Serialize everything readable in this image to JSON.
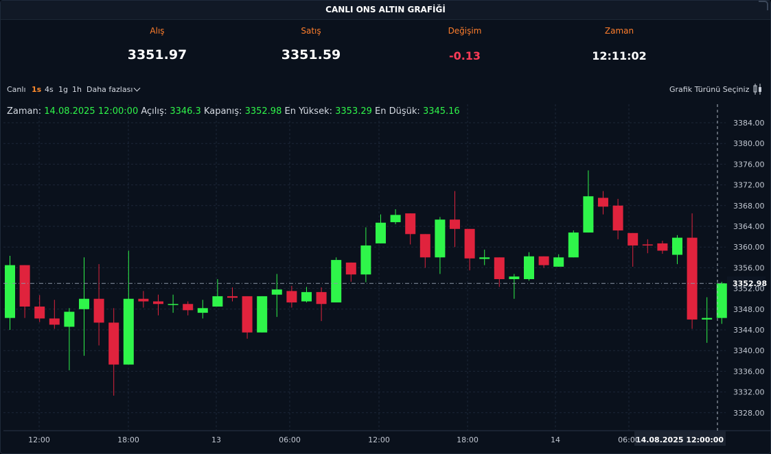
{
  "header": {
    "title": "CANLI ONS ALTIN GRAFİĞİ"
  },
  "quotes": {
    "bid": {
      "label": "Alış",
      "value": "3351.97"
    },
    "ask": {
      "label": "Satış",
      "value": "3351.59"
    },
    "change": {
      "label": "Değişim",
      "value": "-0.13"
    },
    "time": {
      "label": "Zaman",
      "value": "12:11:02"
    }
  },
  "toolbar": {
    "live": "Canlı",
    "intervals": [
      "1s",
      "4s",
      "1g",
      "1h"
    ],
    "active_interval": "1s",
    "more": "Daha fazlası",
    "chart_type": "Grafik Türünü Seçiniz"
  },
  "ohlc": {
    "time_label": "Zaman:",
    "time_value": "14.08.2025 12:00:00",
    "open_label": "Açılış:",
    "open_value": "3346.3",
    "close_label": "Kapanış:",
    "close_value": "3352.98",
    "high_label": "En Yüksek:",
    "high_value": "3353.29",
    "low_label": "En Düşük:",
    "low_value": "3345.16"
  },
  "colors": {
    "up": "#2ff54a",
    "down": "#e0233d",
    "accent": "#ff8b2c",
    "background": "#050a14"
  },
  "chart_data": {
    "type": "candlestick",
    "ylim": [
      3325,
      3387
    ],
    "y_ticks": [
      "3384.00",
      "3380.00",
      "3376.00",
      "3372.00",
      "3368.00",
      "3364.00",
      "3360.00",
      "3356.00",
      "3352.00",
      "3348.00",
      "3344.00",
      "3340.00",
      "3336.00",
      "3332.00",
      "3328.00"
    ],
    "x_ticks": [
      "12:00",
      "18:00",
      "13",
      "06:00",
      "12:00",
      "18:00",
      "14",
      "06:00"
    ],
    "last_price": "3352.98",
    "crosshair_label": "14.08.2025   12:00:00",
    "candles": [
      {
        "open": 3346.3,
        "close": 3356.5,
        "high": 3358.3,
        "low": 3344.0
      },
      {
        "open": 3356.5,
        "close": 3348.5,
        "high": 3356.5,
        "low": 3346.3
      },
      {
        "open": 3348.5,
        "close": 3346.2,
        "high": 3350.7,
        "low": 3345.5
      },
      {
        "open": 3346.2,
        "close": 3345.0,
        "high": 3349.8,
        "low": 3344.2
      },
      {
        "open": 3344.6,
        "close": 3347.5,
        "high": 3348.2,
        "low": 3336.2
      },
      {
        "open": 3348.0,
        "close": 3350.0,
        "high": 3358.0,
        "low": 3339.0
      },
      {
        "open": 3350.0,
        "close": 3345.4,
        "high": 3356.7,
        "low": 3341.0
      },
      {
        "open": 3345.4,
        "close": 3337.3,
        "high": 3348.2,
        "low": 3331.3
      },
      {
        "open": 3337.3,
        "close": 3350.0,
        "high": 3359.3,
        "low": 3337.3
      },
      {
        "open": 3350.0,
        "close": 3349.5,
        "high": 3351.5,
        "low": 3348.3
      },
      {
        "open": 3349.5,
        "close": 3349.0,
        "high": 3350.8,
        "low": 3346.8
      },
      {
        "open": 3349.0,
        "close": 3349.0,
        "high": 3350.8,
        "low": 3347.3
      },
      {
        "open": 3349.0,
        "close": 3347.8,
        "high": 3349.5,
        "low": 3346.8
      },
      {
        "open": 3347.3,
        "close": 3348.2,
        "high": 3349.8,
        "low": 3346.2
      },
      {
        "open": 3348.5,
        "close": 3350.5,
        "high": 3353.8,
        "low": 3348.5
      },
      {
        "open": 3350.5,
        "close": 3350.2,
        "high": 3352.2,
        "low": 3349.5
      },
      {
        "open": 3350.5,
        "close": 3343.5,
        "high": 3350.5,
        "low": 3342.3
      },
      {
        "open": 3343.5,
        "close": 3350.5,
        "high": 3350.5,
        "low": 3343.5
      },
      {
        "open": 3350.8,
        "close": 3351.8,
        "high": 3354.8,
        "low": 3346.5
      },
      {
        "open": 3351.5,
        "close": 3349.3,
        "high": 3352.5,
        "low": 3348.3
      },
      {
        "open": 3349.5,
        "close": 3351.3,
        "high": 3352.3,
        "low": 3349.3
      },
      {
        "open": 3351.3,
        "close": 3349.0,
        "high": 3352.2,
        "low": 3345.7
      },
      {
        "open": 3349.3,
        "close": 3357.5,
        "high": 3358.0,
        "low": 3349.3
      },
      {
        "open": 3357.0,
        "close": 3354.7,
        "high": 3357.0,
        "low": 3353.3
      },
      {
        "open": 3354.7,
        "close": 3360.3,
        "high": 3363.8,
        "low": 3353.2
      },
      {
        "open": 3360.7,
        "close": 3364.7,
        "high": 3366.3,
        "low": 3360.7
      },
      {
        "open": 3364.8,
        "close": 3366.2,
        "high": 3367.3,
        "low": 3364.4
      },
      {
        "open": 3366.5,
        "close": 3362.5,
        "high": 3366.5,
        "low": 3360.5
      },
      {
        "open": 3362.5,
        "close": 3358.0,
        "high": 3362.5,
        "low": 3356.0
      },
      {
        "open": 3358.0,
        "close": 3365.3,
        "high": 3365.8,
        "low": 3354.8
      },
      {
        "open": 3365.3,
        "close": 3363.5,
        "high": 3370.8,
        "low": 3360.0
      },
      {
        "open": 3363.5,
        "close": 3357.8,
        "high": 3363.5,
        "low": 3355.5
      },
      {
        "open": 3357.7,
        "close": 3358.0,
        "high": 3359.5,
        "low": 3356.5
      },
      {
        "open": 3358.0,
        "close": 3353.8,
        "high": 3358.0,
        "low": 3352.3
      },
      {
        "open": 3353.8,
        "close": 3354.3,
        "high": 3354.8,
        "low": 3350.0
      },
      {
        "open": 3353.8,
        "close": 3358.2,
        "high": 3359.0,
        "low": 3353.5
      },
      {
        "open": 3358.2,
        "close": 3356.5,
        "high": 3358.2,
        "low": 3356.0
      },
      {
        "open": 3356.2,
        "close": 3358.0,
        "high": 3358.6,
        "low": 3356.2
      },
      {
        "open": 3358.0,
        "close": 3362.8,
        "high": 3363.2,
        "low": 3358.0
      },
      {
        "open": 3362.8,
        "close": 3369.8,
        "high": 3374.8,
        "low": 3362.8
      },
      {
        "open": 3369.5,
        "close": 3367.8,
        "high": 3370.8,
        "low": 3366.3
      },
      {
        "open": 3368.0,
        "close": 3363.2,
        "high": 3369.3,
        "low": 3361.5
      },
      {
        "open": 3362.7,
        "close": 3360.3,
        "high": 3362.7,
        "low": 3356.2
      },
      {
        "open": 3360.5,
        "close": 3360.3,
        "high": 3361.5,
        "low": 3358.8
      },
      {
        "open": 3360.7,
        "close": 3359.3,
        "high": 3361.2,
        "low": 3358.7
      },
      {
        "open": 3358.5,
        "close": 3361.8,
        "high": 3362.3,
        "low": 3356.7
      },
      {
        "open": 3361.8,
        "close": 3346.0,
        "high": 3366.5,
        "low": 3344.2
      },
      {
        "open": 3346.0,
        "close": 3346.3,
        "high": 3350.3,
        "low": 3341.5
      },
      {
        "open": 3346.3,
        "close": 3352.98,
        "high": 3353.29,
        "low": 3345.16
      }
    ]
  }
}
